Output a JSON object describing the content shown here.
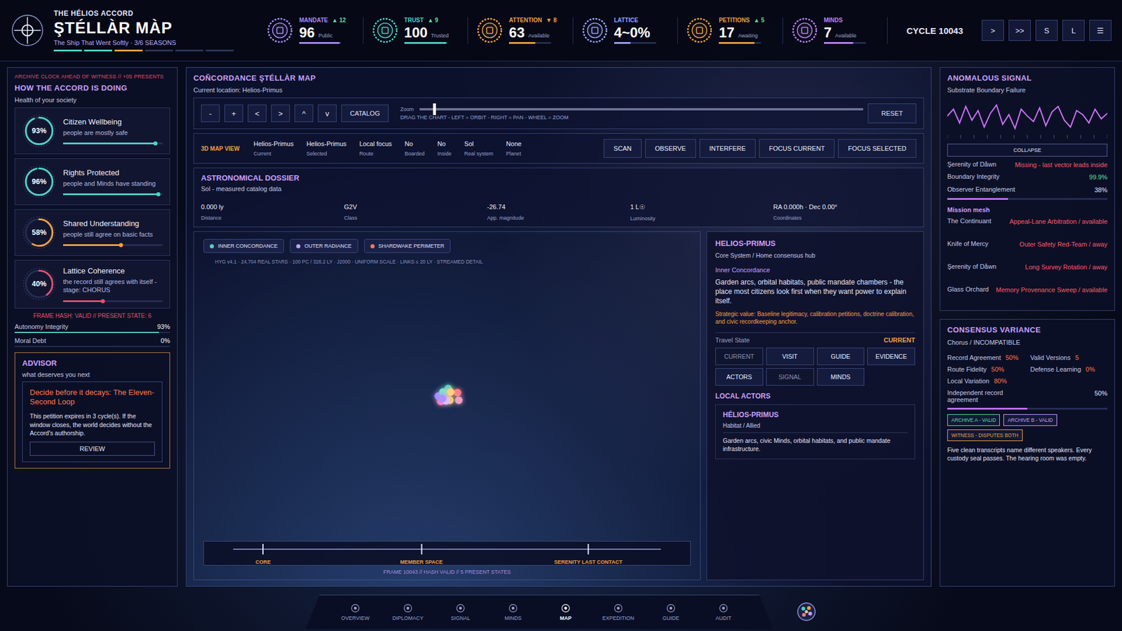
{
  "header": {
    "org": "THE HÉLIOS ACCORD",
    "title": "ŞTÉLLÀR MÀP",
    "subtitle": "The Ship That Went Softly · 3/6 SEASONS",
    "seasons": [
      {
        "done": true,
        "color": "#4fd1c5"
      },
      {
        "done": true,
        "color": "#4fd1c5"
      },
      {
        "done": true,
        "color": "#f0a040"
      },
      {
        "done": false,
        "color": "#4fd1c5"
      },
      {
        "done": false,
        "color": "#4fd1c5"
      },
      {
        "done": false,
        "color": "#4fd1c5"
      }
    ]
  },
  "stats": [
    {
      "label": "MANDATE",
      "delta": "▲ 12",
      "trend": "up",
      "value": "96",
      "sub": "Public",
      "level": 0.96,
      "color": "#a98bff"
    },
    {
      "label": "TRUST",
      "delta": "▲ 9",
      "trend": "up",
      "value": "100",
      "sub": "Trusted",
      "level": 1.0,
      "color": "#4fd1c5"
    },
    {
      "label": "ATTENTION",
      "delta": "▼ 8",
      "trend": "down",
      "value": "63",
      "sub": "Available",
      "level": 0.63,
      "color": "#f0a040"
    },
    {
      "label": "LATTICE",
      "value": "4~0%",
      "level": 0.4,
      "color": "#9aa2ff"
    },
    {
      "label": "PETITIONS",
      "delta": "▲ 5",
      "trend": "up",
      "value": "17",
      "sub": "Awaiting",
      "level": 0.85,
      "color": "#e8a040"
    },
    {
      "label": "MINDS",
      "value": "7",
      "sub": "Available",
      "level": 0.7,
      "color": "#c080ff"
    }
  ],
  "cycle": "CYCLE 10043",
  "time_controls": [
    ">",
    ">>",
    "S",
    "L",
    "☰"
  ],
  "left": {
    "alert": "ARCHIVE CLOCK AHEAD OF WITNESS // +05 PRESENTS",
    "title": "HOW THE ACCORD IS DOING",
    "subtitle": "Health of your society",
    "cards": [
      {
        "title": "Citizen Wellbeing",
        "value": "93%",
        "desc": "people are mostly safe",
        "level": 0.93,
        "color": "#4fd1c5"
      },
      {
        "title": "Rights Protected",
        "value": "96%",
        "desc": "people and Minds have standing",
        "level": 0.96,
        "color": "#4fd1c5"
      },
      {
        "title": "Shared Understanding",
        "value": "58%",
        "desc": "people still agree on basic facts",
        "level": 0.58,
        "color": "#f0a040"
      },
      {
        "title": "Lattice Coherence",
        "value": "40%",
        "desc": "the record still agrees with itself - stage: CHORUS",
        "level": 0.4,
        "color": "#e0506a"
      }
    ],
    "hash": "FRAME HASH: VALID // PRESENT STATE: 6",
    "meters": [
      {
        "label": "Autonomy Integrity",
        "value": "93%",
        "level": 0.93,
        "color": "#4fd1c5"
      },
      {
        "label": "Moral Debt",
        "value": "0%",
        "level": 0,
        "color": "#4fd1c5"
      }
    ],
    "advisor": {
      "title": "ADVISOR",
      "subtitle": "what deserves you next",
      "heading": "Decide before it decays: The Eleven-Second Loop",
      "body": "This petition expires in 3 cycle(s). If the window closes, the world decides without the Accord's authorship.",
      "button": "REVIEW"
    }
  },
  "map": {
    "title": "COŇCORDANCE ŞTÉLLÀR MAP",
    "location": "Current location: Helios-Primus",
    "nav_buttons": [
      "-",
      "+",
      "<",
      ">",
      "^",
      "v"
    ],
    "catalog": "CATALOG",
    "zoom": {
      "label": "Zoom",
      "level": 0.03,
      "hint": "DRAG THE CHART - LEFT = ORBIT - RIGHT = PAN - WHEEL = ZOOM"
    },
    "reset": "RESET",
    "view": {
      "label": "3D MAP VIEW",
      "fields": [
        {
          "value": "Helios-Primus",
          "label": "Current"
        },
        {
          "value": "Helios-Primus",
          "label": "Selected"
        },
        {
          "value": "Local focus",
          "label": "Route"
        },
        {
          "value": "No",
          "label": "Boarded"
        },
        {
          "value": "No",
          "label": "Inside"
        },
        {
          "value": "Sol",
          "label": "Real system"
        },
        {
          "value": "None",
          "label": "Planet"
        }
      ],
      "actions": [
        "SCAN",
        "OBSERVE",
        "INTERFERE",
        "FOCUS CURRENT",
        "FOCUS SELECTED"
      ]
    },
    "dossier": {
      "title": "ASTRONOMICAL DOSSIER",
      "subtitle": "Sol - measured catalog data",
      "fields": [
        {
          "value": "0.000 ly",
          "label": "Distance"
        },
        {
          "value": "G2V",
          "label": "Class"
        },
        {
          "value": "-26.74",
          "label": "App. magnitude"
        },
        {
          "value": "1 L☉",
          "label": "Luminosity"
        },
        {
          "value": "RA 0.000h · Dec 0.00°",
          "label": "Coordinates"
        }
      ]
    },
    "legend": [
      {
        "label": "INNER CONCORDANCE",
        "color": "#4fd1c5"
      },
      {
        "label": "OUTER RADIANCE",
        "color": "#c9a0ff"
      },
      {
        "label": "SHARDWAKE PERIMETER",
        "color": "#ff7a50"
      }
    ],
    "caption": "HYG v4.1 · 24,704 REAL STARS · 100 PC / 326.2 LY · J2000 · UNIFORM SCALE · LINKS ≤ 20 LY · STREAMED DETAIL",
    "stars": [
      {
        "color": "#c9a0ff"
      },
      {
        "color": "#ff7aa8"
      },
      {
        "color": "#4fd1c5"
      },
      {
        "color": "#f0d060"
      },
      {
        "color": "#a98bff"
      },
      {
        "color": "#ff7a80"
      },
      {
        "color": "#e8c0ff"
      },
      {
        "color": "#7fe0d0"
      },
      {
        "color": "#f0a0c0"
      },
      {
        "color": "#b090ff"
      },
      {
        "color": "#ffd080"
      }
    ],
    "timeline": [
      {
        "label": "CORE",
        "level": 0.07
      },
      {
        "label": "MEMBER SPACE",
        "level": 0.44
      },
      {
        "label": "SERENITY LAST CONTACT",
        "level": 0.83
      }
    ],
    "frame": "FRAME 10043 // HASH VALID // 5 PRESENT STATES"
  },
  "detail": {
    "title": "HELIOS-PRIMUS",
    "subtitle": "Core System / Home consensus hub",
    "region": "Inner Concordance",
    "description": "Garden arcs, orbital habitats, public mandate chambers - the place most citizens look first when they want power to explain itself.",
    "strategic": "Strategic value: Baseline legitimacy, calibration petitions, doctrine calibration, and civic recordkeeping anchor.",
    "travel_label": "Travel State",
    "travel_value": "CURRENT",
    "buttons": [
      {
        "label": "CURRENT",
        "disabled": true
      },
      {
        "label": "VISIT",
        "disabled": false
      },
      {
        "label": "GUIDE",
        "disabled": false
      },
      {
        "label": "EVIDENCE",
        "disabled": false
      },
      {
        "label": "ACTORS",
        "disabled": false
      },
      {
        "label": "SIGNAL",
        "disabled": true
      },
      {
        "label": "MINDS",
        "disabled": false
      }
    ],
    "actors_title": "LOCAL ACTORS",
    "actors": [
      {
        "name": "HÉLIOS-PRIMUS",
        "type": "Habitat / Allied",
        "desc": "Garden arcs, civic Minds, orbital habitats, and public mandate infrastructure."
      }
    ]
  },
  "signal": {
    "title": "ANOMALOUS SIGNAL",
    "subtitle": "Substrate Boundary Failure",
    "wave": [
      0.1,
      0.6,
      -0.4,
      0.8,
      -0.2,
      0.5,
      -0.7,
      0.3,
      0.9,
      -0.5,
      0.2,
      -0.8,
      0.6,
      0.1,
      -0.3,
      0.7,
      -0.6,
      0.4,
      0.8,
      -0.2,
      -0.7,
      0.5,
      0.2,
      -0.4,
      0.6,
      -0.1,
      0.3
    ],
    "collapse": "COLLAPSE",
    "rows": [
      {
        "label": "Şerenity of Dåwn",
        "value": "Missing - last vector leads inside",
        "color": "#ff5a6a"
      },
      {
        "label": "Boundary Integrity",
        "value": "99.9%",
        "color": "#5fe0a0"
      }
    ],
    "entanglement": {
      "label": "Observer Entanglement",
      "value": "38%",
      "level": 0.38
    },
    "mesh_title": "Mission mesh",
    "mesh": [
      {
        "name": "The Continuant",
        "task": "Appeal-Lane Arbitration / available"
      },
      {
        "name": "Knife of Mercy",
        "task": "Outer Safety Red-Team / away"
      },
      {
        "name": "Şerenity of Dåwn",
        "task": "Long Survey Rotation / away"
      },
      {
        "name": "Glass Orchard",
        "task": "Memory Provenance Sweep / available"
      }
    ]
  },
  "consensus": {
    "title": "CONSENSUS VARIANCE",
    "subtitle": "Chorus / INCOMPATIBLE",
    "metrics": [
      {
        "label": "Record Agreement",
        "value": "50%"
      },
      {
        "label": "Valid Versions",
        "value": "5"
      },
      {
        "label": "Route Fidelity",
        "value": "50%"
      },
      {
        "label": "Defense Learning",
        "value": "0%"
      },
      {
        "label": "Local Variation",
        "value": "80%"
      }
    ],
    "agreement": {
      "label": "Independent record agreement",
      "value": "50%",
      "level": 0.5
    },
    "tags": [
      {
        "label": "ARCHIVE A - VALID",
        "color": "#5fe0a0"
      },
      {
        "label": "ARCHIVE B - VALID",
        "color": "#c9a0ff"
      },
      {
        "label": "WITNESS - DISPUTES BOTH",
        "color": "#f0a040"
      }
    ],
    "note": "Five clean transcripts name different speakers. Every custody seal passes. The hearing room was empty."
  },
  "nav": [
    {
      "label": "OVERVIEW",
      "selected": false
    },
    {
      "label": "DIPLOMACY",
      "selected": false
    },
    {
      "label": "SIGNAL",
      "selected": false
    },
    {
      "label": "MINDS",
      "selected": false
    },
    {
      "label": "MAP",
      "selected": true
    },
    {
      "label": "EXPEDITION",
      "selected": false
    },
    {
      "label": "GUIDE",
      "selected": false
    },
    {
      "label": "AUDIT",
      "selected": false
    }
  ]
}
